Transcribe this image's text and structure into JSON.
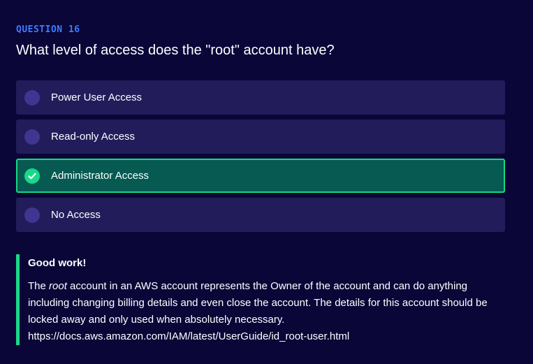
{
  "question": {
    "number_label": "QUESTION 16",
    "text": "What level of access does the \"root\" account have?"
  },
  "options": [
    {
      "label": "Power User Access",
      "selected": false
    },
    {
      "label": "Read-only Access",
      "selected": false
    },
    {
      "label": "Administrator Access",
      "selected": true
    },
    {
      "label": "No Access",
      "selected": false
    }
  ],
  "feedback": {
    "title": "Good work!",
    "text_before_emphasis": "The ",
    "emphasis": "root",
    "text_after_emphasis": " account in an AWS account represents the Owner of the account and can do anything including changing billing details and even close the account. The details for this account should be locked away and only used when absolutely necessary.",
    "link": "https://docs.aws.amazon.com/IAM/latest/UserGuide/id_root-user.html"
  },
  "colors": {
    "background": "#0a0638",
    "accent_blue": "#3d7cff",
    "option_background": "#221d5a",
    "selected_background": "#065a52",
    "correct_green": "#18d98a"
  },
  "icons": {
    "selected_option": "check-circle-icon",
    "unselected_option": "radio-circle-icon"
  }
}
